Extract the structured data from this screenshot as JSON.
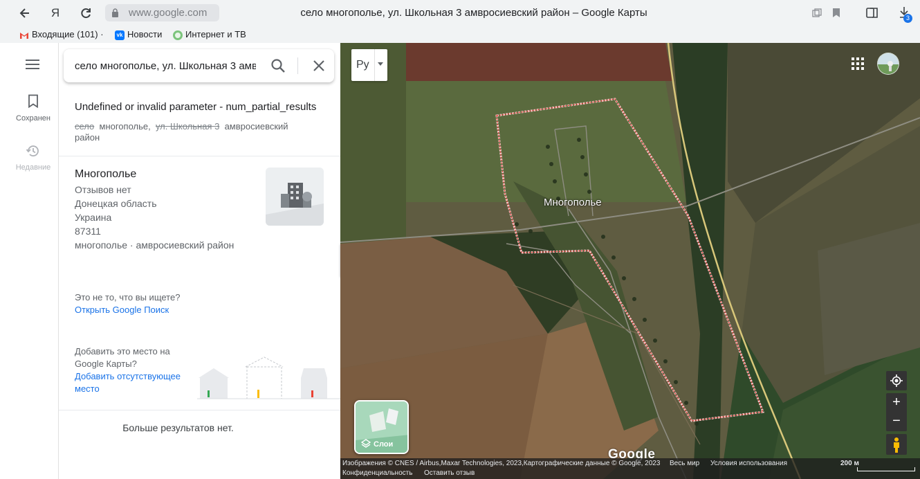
{
  "browser": {
    "address": "www.google.com",
    "tab_title": "село многополье, ул. Школьная 3 амвросиевский район – Google Карты",
    "downloads_badge": "3",
    "back_icon": "arrow-left",
    "yandex_icon": "Я",
    "reload_icon": "reload"
  },
  "bookmarks": [
    {
      "label": "Входящие (101) ·",
      "icon": "gmail-icon"
    },
    {
      "label": "Новости",
      "icon": "vk-icon"
    },
    {
      "label": "Интернет и ТВ",
      "icon": "circle-icon"
    }
  ],
  "rail": {
    "saved_label": "Сохранен",
    "recent_label": "Недавние"
  },
  "search": {
    "value": "село многополье, ул. Школьная 3 амвросиевский район"
  },
  "error": {
    "title": "Undefined or invalid parameter - num_partial_results",
    "tokens": [
      {
        "text": "село",
        "struck": true
      },
      {
        "text": "многополье,",
        "struck": false
      },
      {
        "text": "ул. Школьная 3",
        "struck": true
      },
      {
        "text": "амвросиевский",
        "struck": false
      },
      {
        "text": "район",
        "struck": false
      }
    ]
  },
  "result": {
    "name": "Многополье",
    "reviews": "Отзывов нет",
    "region": "Донецкая область",
    "country": "Украина",
    "postcode": "87311",
    "address": "многополье · амвросиевский район"
  },
  "not_found": {
    "question": "Это не то, что вы ищете?",
    "link": "Открыть Google Поиск"
  },
  "add_place": {
    "text_line1": "Добавить это место на",
    "text_line2": "Google Карты?",
    "link_line1": "Добавить отсутствующее",
    "link_line2": "место"
  },
  "no_more": "Больше результатов нет.",
  "map": {
    "place_label": "Многополье",
    "language_button": "Ру",
    "layers_label": "Слои",
    "logo": "Google",
    "attribution": "Изображения © CNES / Airbus,Maxar Technologies, 2023,Картографические данные © Google, 2023",
    "world_link": "Весь мир",
    "terms_link": "Условия использования",
    "scale": "200 м",
    "privacy_link": "Конфиденциальность",
    "feedback_link": "Оставить отзыв",
    "zoom_in": "+",
    "zoom_out": "−"
  }
}
